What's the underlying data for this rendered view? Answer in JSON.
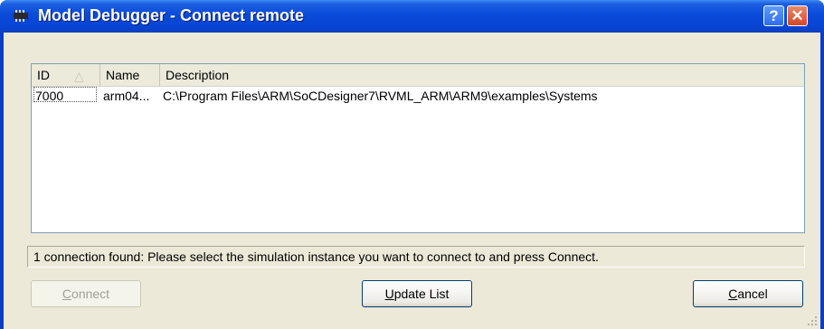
{
  "window": {
    "title": "Model Debugger - Connect remote",
    "help_label": "?",
    "close_label": "✕"
  },
  "list": {
    "columns": [
      "ID",
      "Name",
      "Description"
    ],
    "sort_indicator": "△",
    "rows": [
      {
        "id": "7000",
        "name": "arm04...",
        "description": "C:\\Program Files\\ARM\\SoCDesigner7\\RVML_ARM\\ARM9\\examples\\Systems"
      }
    ]
  },
  "status": {
    "text": "1 connection found: Please select the simulation instance you want to connect to and press Connect."
  },
  "buttons": {
    "connect": {
      "first": "C",
      "rest": "onnect",
      "enabled": false
    },
    "update": {
      "first": "U",
      "rest": "pdate List"
    },
    "cancel": {
      "first": "C",
      "rest": "ancel"
    }
  },
  "icons": {
    "app": "chip-icon",
    "help": "help-icon",
    "close": "close-icon",
    "grip": "resize-grip-icon"
  }
}
